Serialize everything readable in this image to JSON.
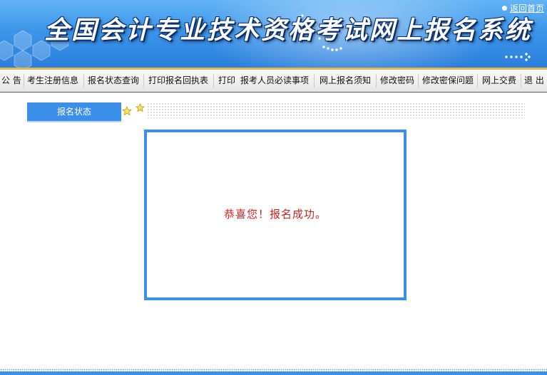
{
  "banner": {
    "title": "全国会计专业技术资格考试网上报名系统",
    "home_link": "返回首页"
  },
  "nav": {
    "items": [
      {
        "label": "公 告"
      },
      {
        "label": "考生注册信息"
      },
      {
        "label": "报名状态查询"
      },
      {
        "label": "打印报名回执表"
      },
      {
        "label": "打印"
      },
      {
        "label": "报考人员必读事项"
      },
      {
        "label": "网上报名须知"
      },
      {
        "label": "修改密码"
      },
      {
        "label": "修改密保问题"
      },
      {
        "label": "网上交费"
      },
      {
        "label": "退 出"
      }
    ]
  },
  "section": {
    "tab_label": "报名状态"
  },
  "message": {
    "text": "恭喜您！报名成功。"
  },
  "colors": {
    "accent": "#3b8fe8",
    "message": "#d81e1e",
    "gold": "#e8b84a"
  },
  "icons": {
    "star": "star-icon",
    "home_dot": "bullet-icon"
  }
}
